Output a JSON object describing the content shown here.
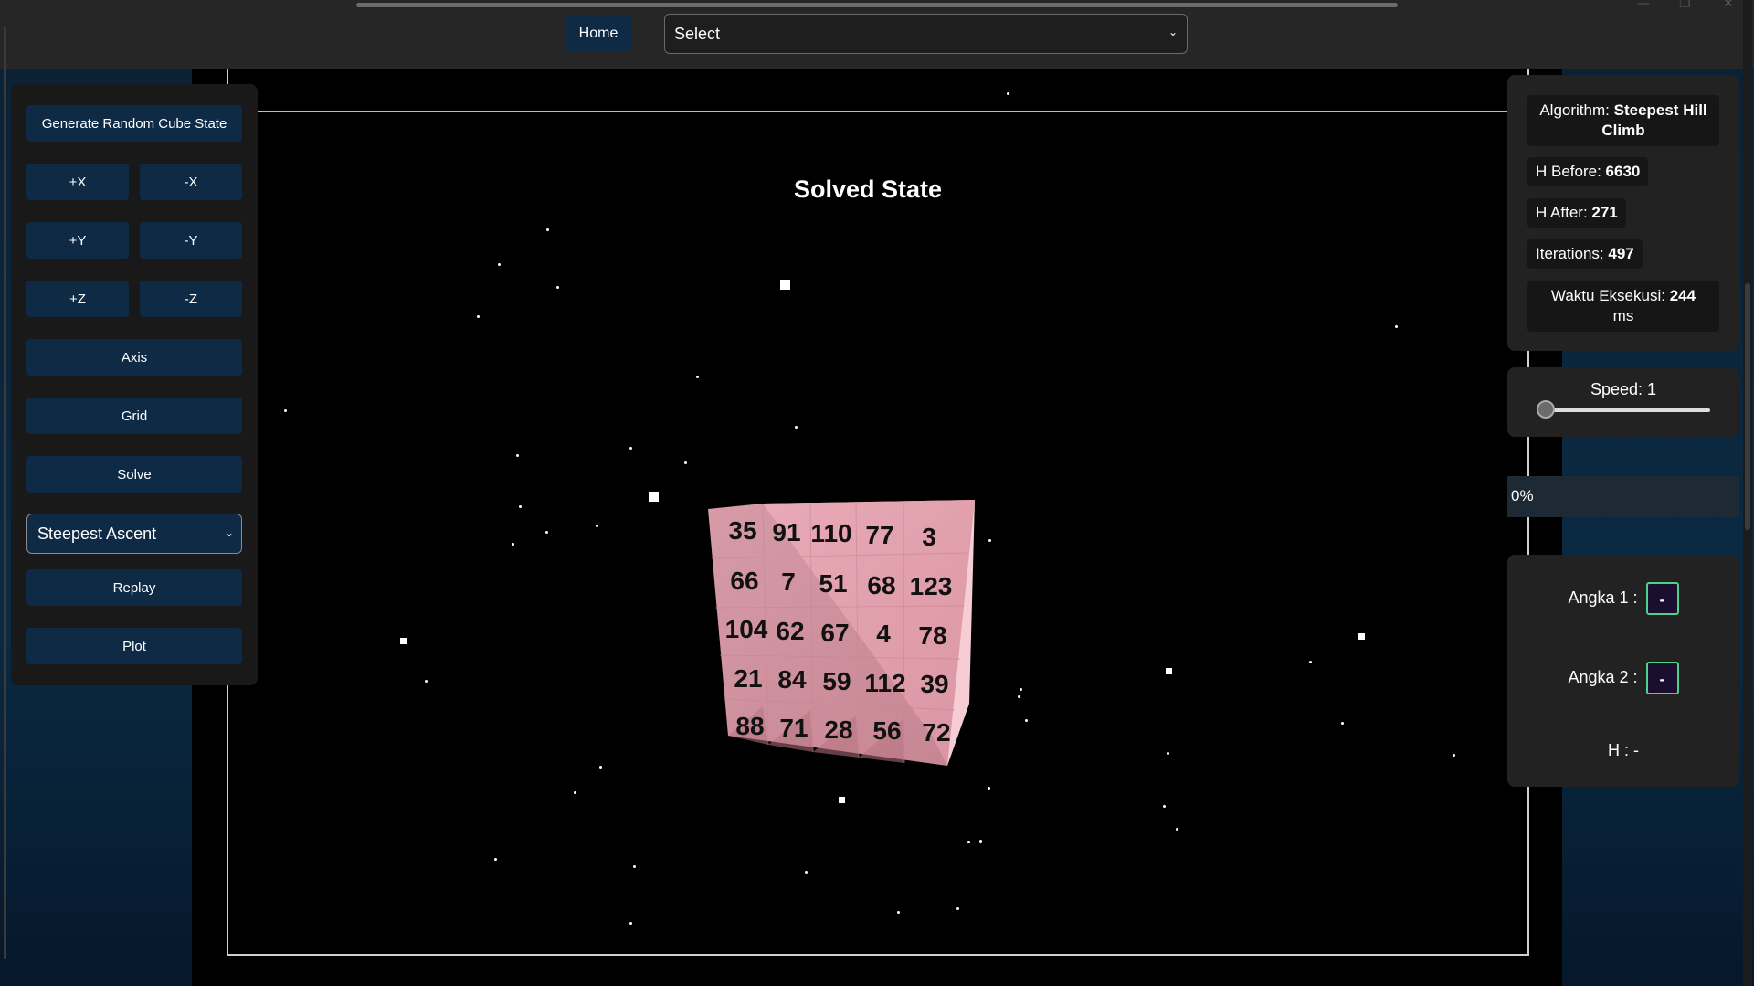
{
  "topbar": {
    "home_label": "Home",
    "select_value": "Select",
    "window_controls": [
      "—",
      "❐",
      "✕"
    ]
  },
  "scene": {
    "title": "Solved State"
  },
  "left_panel": {
    "generate_label": "Generate Random Cube State",
    "rotate_buttons": [
      "+X",
      "-X",
      "+Y",
      "-Y",
      "+Z",
      "-Z"
    ],
    "axis_label": "Axis",
    "grid_label": "Grid",
    "solve_label": "Solve",
    "algorithm_select": "Steepest Ascent",
    "replay_label": "Replay",
    "plot_label": "Plot"
  },
  "stats": {
    "algorithm_label": "Algorithm:",
    "algorithm_value": "Steepest Hill Climb",
    "h_before_label": "H Before:",
    "h_before_value": "6630",
    "h_after_label": "H After:",
    "h_after_value": "271",
    "iterations_label": "Iterations:",
    "iterations_value": "497",
    "time_label": "Waktu Eksekusi:",
    "time_value": "244",
    "time_unit": "ms"
  },
  "speed": {
    "label": "Speed: 1",
    "value": 1
  },
  "progress": {
    "text": "0%",
    "fraction": 0
  },
  "compare": {
    "angka1_label": "Angka 1 :",
    "angka1_value": "-",
    "angka2_label": "Angka 2 :",
    "angka2_value": "-",
    "h_label": "H : -"
  },
  "cube": {
    "front_numbers": [
      [
        "35",
        "91",
        "110",
        "77",
        "3"
      ],
      [
        "66",
        "7",
        "51",
        "68",
        "123"
      ],
      [
        "104",
        "62",
        "67",
        "4",
        "78"
      ],
      [
        "21",
        "84",
        "59",
        "112",
        "39"
      ],
      [
        "88",
        "71",
        "28",
        "56",
        "72"
      ]
    ],
    "face_color": "#f3b9c4"
  }
}
